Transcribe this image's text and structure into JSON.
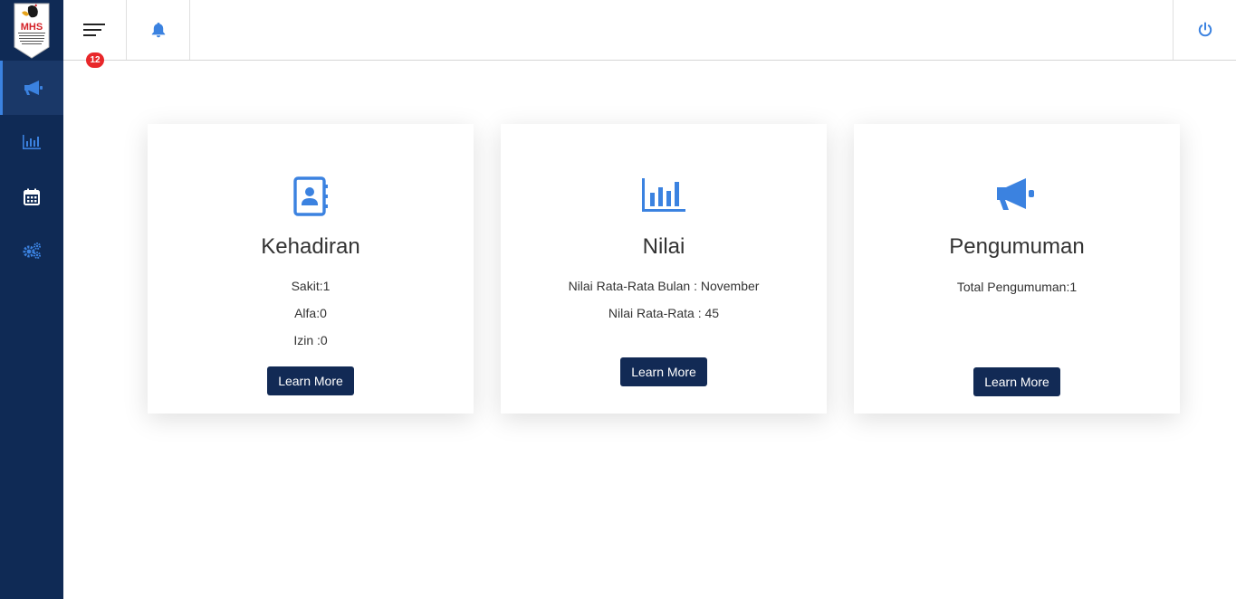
{
  "brand": {
    "logo_text": "MHS",
    "logo_subtitle": "HI TECH PERSONALITY GLOBAL"
  },
  "sidebar": {
    "items": [
      {
        "icon": "megaphone-icon",
        "active": true
      },
      {
        "icon": "bar-chart-icon",
        "active": false
      },
      {
        "icon": "calendar-icon",
        "active": false
      },
      {
        "icon": "gears-icon",
        "active": false
      }
    ]
  },
  "topbar": {
    "notification_count": "12"
  },
  "cards": [
    {
      "icon": "address-book-icon",
      "title": "Kehadiran",
      "lines": [
        "Sakit:1",
        "Alfa:0",
        "Izin :0"
      ],
      "button": "Learn More"
    },
    {
      "icon": "bar-chart-icon",
      "title": "Nilai",
      "lines": [
        "Nilai Rata-Rata Bulan : November",
        "Nilai Rata-Rata : 45"
      ],
      "button": "Learn More"
    },
    {
      "icon": "megaphone-icon",
      "title": "Pengumuman",
      "lines": [
        "Total Pengumuman:1"
      ],
      "button": "Learn More"
    }
  ],
  "colors": {
    "sidebar_bg": "#0f2a55",
    "accent": "#3b82e0",
    "button_bg": "#122a55",
    "badge": "#e8272a"
  }
}
